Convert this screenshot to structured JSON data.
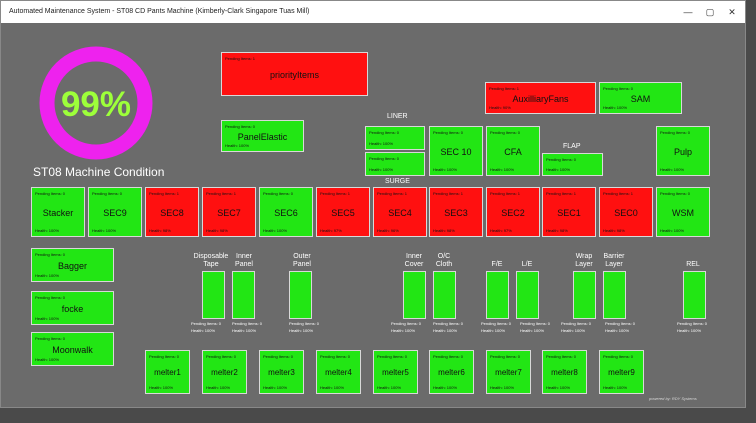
{
  "window": {
    "title": "Automated Maintenance System - ST08 CD Pants Machine (Kimberly-Clark Singapore Tuas Mill)",
    "minimize": "—",
    "maximize": "▢",
    "close": "✕"
  },
  "gauge": {
    "value_text": "99%",
    "percent": 99,
    "ring_color": "#ee22ee"
  },
  "machine_title": "ST08 Machine Condition",
  "colors": {
    "ok": "#22e614",
    "alarm": "#ff1010"
  },
  "sections": {
    "liner": "LINER",
    "surge": "SURGE",
    "flap": "FLAP"
  },
  "tiles": {
    "priority": {
      "name": "priorityItems",
      "pending": "Pending Items: 1",
      "health": ""
    },
    "panel_elastic": {
      "name": "PanelElastic",
      "pending": "Pending Items: 0",
      "health": "Health: 100%"
    },
    "auxiliary": {
      "name": "AuxilliaryFans",
      "pending": "Pending Items: 1",
      "health": "Health: 90%"
    },
    "sam": {
      "name": "SAM",
      "pending": "Pending Items: 0",
      "health": "Health: 100%"
    },
    "liner1": {
      "name": "",
      "pending": "Pending Items: 0",
      "health": "Health: 100%"
    },
    "liner2": {
      "name": "",
      "pending": "Pending Items: 0",
      "health": "Health: 100%"
    },
    "sec10": {
      "name": "SEC 10",
      "pending": "Pending Items: 0",
      "health": "Health: 100%"
    },
    "cfa": {
      "name": "CFA",
      "pending": "Pending Items: 0",
      "health": "Health: 100%"
    },
    "flap": {
      "name": "",
      "pending": "Pending Items: 0",
      "health": "Health: 100%"
    },
    "pulp": {
      "name": "Pulp",
      "pending": "Pending Items: 0",
      "health": "Health: 100%"
    },
    "stacker": {
      "name": "Stacker",
      "pending": "Pending Items: 0",
      "health": "Health: 100%"
    },
    "sec9": {
      "name": "SEC9",
      "pending": "Pending Items: 0",
      "health": "Health: 100%"
    },
    "sec8": {
      "name": "SEC8",
      "pending": "Pending Items: 1",
      "health": "Health: 98%"
    },
    "sec7": {
      "name": "SEC7",
      "pending": "Pending Items: 1",
      "health": "Health: 98%"
    },
    "sec6": {
      "name": "SEC6",
      "pending": "Pending Items: 0",
      "health": "Health: 100%"
    },
    "sec5": {
      "name": "SEC5",
      "pending": "Pending Items: 1",
      "health": "Health: 97%"
    },
    "sec4": {
      "name": "SEC4",
      "pending": "Pending Items: 1",
      "health": "Health: 96%"
    },
    "sec3": {
      "name": "SEC3",
      "pending": "Pending Items: 1",
      "health": "Health: 98%"
    },
    "sec2": {
      "name": "SEC2",
      "pending": "Pending Items: 1",
      "health": "Health: 97%"
    },
    "sec1": {
      "name": "SEC1",
      "pending": "Pending Items: 1",
      "health": "Health: 98%"
    },
    "sec0": {
      "name": "SEC0",
      "pending": "Pending Items: 1",
      "health": "Health: 98%"
    },
    "wsm": {
      "name": "WSM",
      "pending": "Pending Items: 0",
      "health": "Health: 100%"
    },
    "bagger": {
      "name": "Bagger",
      "pending": "Pending Items: 0",
      "health": "Health: 100%"
    },
    "focke": {
      "name": "focke",
      "pending": "Pending Items: 0",
      "health": "Health: 100%"
    },
    "moonwalk": {
      "name": "Moonwalk",
      "pending": "Pending Items: 0",
      "health": "Health: 100%"
    },
    "melter1": {
      "name": "melter1",
      "pending": "Pending Items: 0",
      "health": "Health: 100%"
    },
    "melter2": {
      "name": "melter2",
      "pending": "Pending Items: 0",
      "health": "Health: 100%"
    },
    "melter3": {
      "name": "melter3",
      "pending": "Pending Items: 0",
      "health": "Health: 100%"
    },
    "melter4": {
      "name": "melter4",
      "pending": "Pending Items: 0",
      "health": "Health: 100%"
    },
    "melter5": {
      "name": "melter5",
      "pending": "Pending Items: 0",
      "health": "Health: 100%"
    },
    "melter6": {
      "name": "melter6",
      "pending": "Pending Items: 0",
      "health": "Health: 100%"
    },
    "melter7": {
      "name": "melter7",
      "pending": "Pending Items: 0",
      "health": "Health: 100%"
    },
    "melter8": {
      "name": "melter8",
      "pending": "Pending Items: 0",
      "health": "Health: 100%"
    },
    "melter9": {
      "name": "melter9",
      "pending": "Pending Items: 0",
      "health": "Health: 100%"
    }
  },
  "bars": {
    "disposable_tape": {
      "label": "Disposable\nTape",
      "pending": "Pending Items: 0",
      "health": "Health: 100%"
    },
    "inner_panel": {
      "label": "Inner\nPanel",
      "pending": "Pending Items: 0",
      "health": "Health: 100%"
    },
    "outer_panel": {
      "label": "Outer\nPanel",
      "pending": "Pending Items: 0",
      "health": "Health: 100%"
    },
    "inner_cover": {
      "label": "Inner\nCover",
      "pending": "Pending Items: 0",
      "health": "Health: 100%"
    },
    "oc_cloth": {
      "label": "O/C\nCloth",
      "pending": "Pending Items: 0",
      "health": "Health: 100%"
    },
    "fe": {
      "label": "F/E",
      "pending": "Pending Items: 0",
      "health": "Health: 100%"
    },
    "le": {
      "label": "L/E",
      "pending": "Pending Items: 0",
      "health": "Health: 100%"
    },
    "wrap_layer": {
      "label": "Wrap\nLayer",
      "pending": "Pending Items: 0",
      "health": "Health: 100%"
    },
    "barrier_layer": {
      "label": "Barrier\nLayer",
      "pending": "Pending Items: 0",
      "health": "Health: 100%"
    },
    "rel": {
      "label": "REL",
      "pending": "Pending Items: 0",
      "health": "Health: 100%"
    }
  },
  "footer": {
    "credit": "powered by: RDY Systems"
  }
}
